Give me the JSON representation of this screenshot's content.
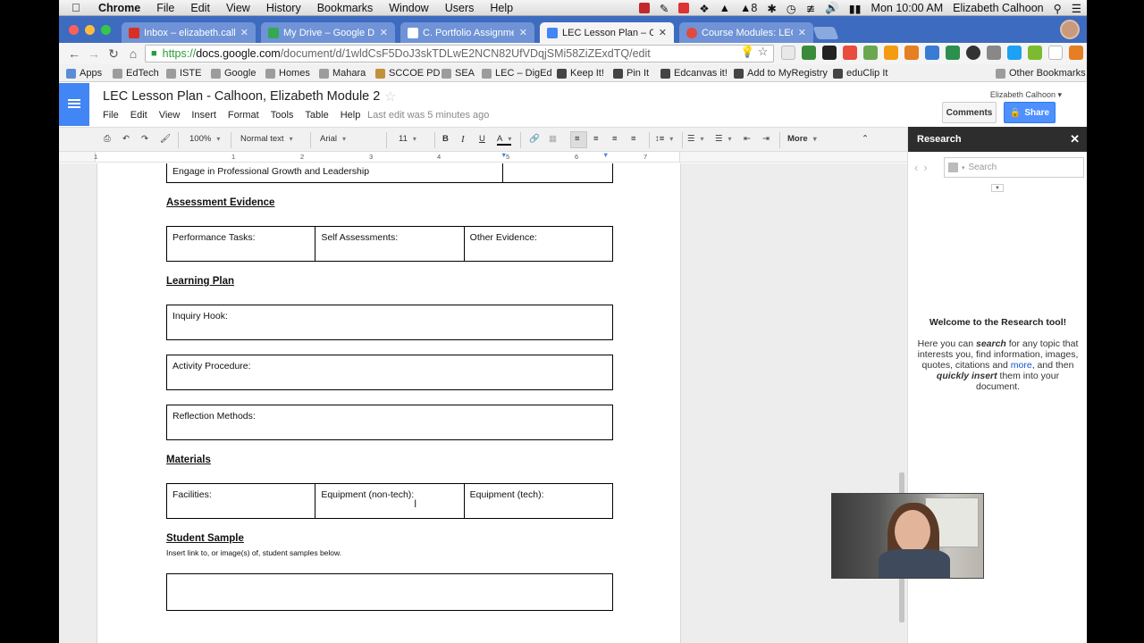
{
  "menubar": {
    "app": "Chrome",
    "items": [
      "File",
      "Edit",
      "View",
      "History",
      "Bookmarks",
      "Window",
      "Users",
      "Help"
    ],
    "clock": "Mon 10:00 AM",
    "user": "Elizabeth Calhoon",
    "badge": "8"
  },
  "tabs": [
    {
      "label": "Inbox – elizabeth.calhoon",
      "color": "#d93025"
    },
    {
      "label": "My Drive – Google Drive",
      "color": "#34a853"
    },
    {
      "label": "C. Portfolio Assignment –",
      "color": "#ffffff"
    },
    {
      "label": "LEC Lesson Plan – Calhoon",
      "color": "#4285f4"
    },
    {
      "label": "Course Modules: LEC Digit",
      "color": "#e04a3f"
    }
  ],
  "address": {
    "scheme": "https://",
    "host": "docs.google.com",
    "path": "/document/d/1wldCsF5DoJ3skTDLwE2NCN82UfVDqjSMi58ZiZExdTQ/edit"
  },
  "bookmarks": [
    "Apps",
    "EdTech",
    "ISTE",
    "Google",
    "Homes",
    "Mahara",
    "SCCOE PD",
    "SEA",
    "LEC – DigEd",
    "Keep It!",
    "Pin It",
    "Edcanvas it!",
    "Add to MyRegistry",
    "eduClip It",
    "Other Bookmarks"
  ],
  "doc": {
    "title": "LEC Lesson Plan - Calhoon, Elizabeth Module 2",
    "menu": [
      "File",
      "Edit",
      "View",
      "Insert",
      "Format",
      "Tools",
      "Table",
      "Help"
    ],
    "last_edit": "Last edit was 5 minutes ago",
    "account": "Elizabeth Calhoon",
    "comments_label": "Comments",
    "share_label": "Share"
  },
  "format_toolbar": {
    "zoom": "100%",
    "style": "Normal text",
    "font": "Arial",
    "size": "11",
    "more": "More"
  },
  "ruler_numbers": [
    "1",
    "1",
    "2",
    "3",
    "4",
    "5",
    "6",
    "7"
  ],
  "content": {
    "top_row": "Engage in Professional Growth and Leadership",
    "assessment_heading": "Assessment Evidence",
    "assessment_cells": [
      "Performance Tasks:",
      "Self Assessments:",
      "Other Evidence:"
    ],
    "learning_heading": "Learning Plan",
    "inquiry": "Inquiry Hook:",
    "activity": "Activity Procedure:",
    "reflection": "Reflection Methods:",
    "materials_heading": "Materials",
    "materials_cells": [
      "Facilities:",
      "Equipment (non-tech):",
      "Equipment (tech):"
    ],
    "sample_heading": "Student Sample",
    "sample_note": "Insert link to, or image(s) of, student samples below."
  },
  "research": {
    "title": "Research",
    "search_placeholder": "Search",
    "welcome": "Welcome to the Research tool!",
    "body_1": "Here you can ",
    "body_search": "search",
    "body_2": " for any topic that interests you, find information, images, quotes, citations and ",
    "body_more": "more",
    "body_3": ", and then ",
    "body_insert": "quickly insert",
    "body_4": " them into your document."
  }
}
